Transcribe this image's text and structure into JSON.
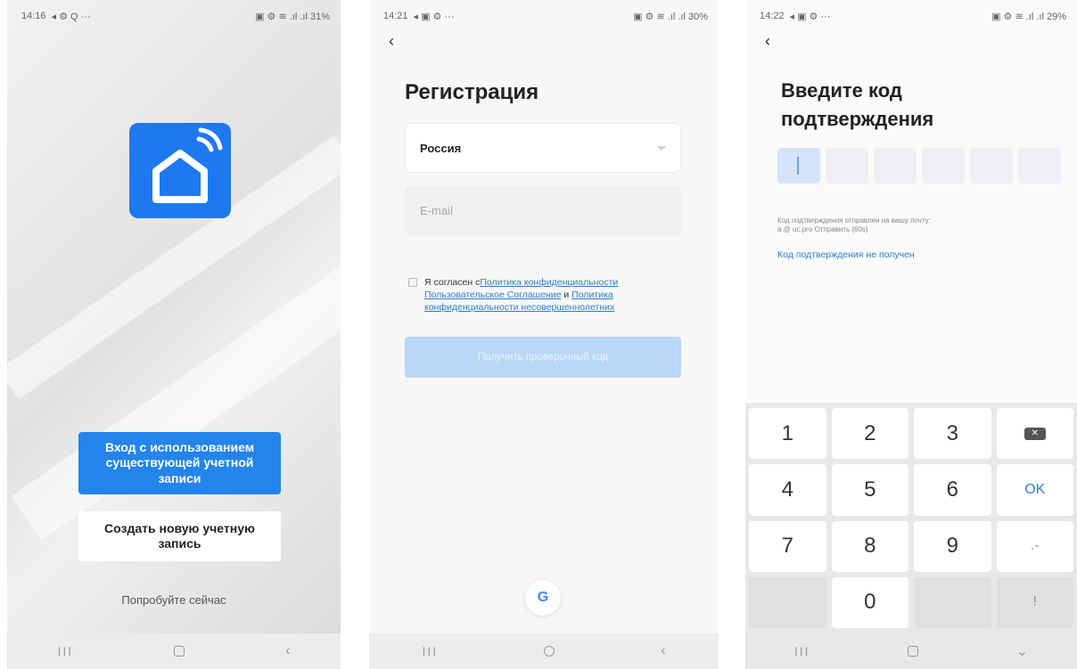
{
  "screen1": {
    "status": {
      "time": "14:16",
      "icons_left": "◂ ⚙ Q ···",
      "icons_right": "▣ ⚙ ≋ .ıl .ıl 31%"
    },
    "login_button": "Вход с использованием существующей учетной записи",
    "create_button": "Создать новую учетную запись",
    "try_now": "Попробуйте сейчас",
    "nav": {
      "recent": "III",
      "back": "‹"
    }
  },
  "screen2": {
    "status": {
      "time": "14:21",
      "icons_left": "◂ ▣ ⚙ ···",
      "icons_right": "▣ ⚙ ≋ .ıl .ıl 30%"
    },
    "back": "‹",
    "title": "Регистрация",
    "country_value": "Россия",
    "email_placeholder": "E-mail",
    "agree": {
      "prefix": "Я согласен с",
      "link1": "Политика конфиденциальности",
      "link2": "Пользовательское Соглашение",
      "and": " и ",
      "link3": "Политика конфиденциальности несовершеннолетних"
    },
    "get_code_button": "Получить проверочный код",
    "google": "G",
    "nav": {
      "recent": "III",
      "back": "‹"
    }
  },
  "screen3": {
    "status": {
      "time": "14:22",
      "icons_left": "◂ ▣ ⚙ ···",
      "icons_right": "▣ ⚙ ≋ .ıl .ıl 29%"
    },
    "back": "‹",
    "title_line1": "Введите код",
    "title_line2": "подтверждения",
    "sent_line1": "Код подтверждения отправлен на вашу почту:",
    "sent_line2": "a  @      uc.pro Отправить (60s)",
    "not_received": "Код подтверждения не получен",
    "keys": [
      "1",
      "2",
      "3",
      "4",
      "5",
      "6",
      "OK",
      "7",
      "8",
      "9",
      ".-",
      "0",
      "!"
    ],
    "nav": {
      "recent": "III",
      "back": "⌄"
    }
  }
}
